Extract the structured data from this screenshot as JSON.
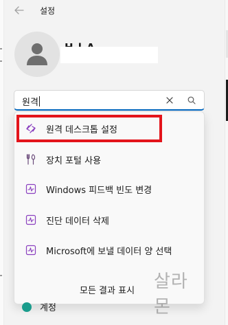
{
  "window": {
    "title": "설정"
  },
  "profile": {
    "name_visible": "H  l  A"
  },
  "search": {
    "value": "원격"
  },
  "results": [
    {
      "label": "원격 데스크톱 설정",
      "icon": "remote-desktop-icon",
      "highlighted": true
    },
    {
      "label": "장치 포털 사용",
      "icon": "tools-icon",
      "highlighted": false
    },
    {
      "label": "Windows 피드백 빈도 변경",
      "icon": "activity-chart-icon",
      "highlighted": false
    },
    {
      "label": "진단 데이터 삭제",
      "icon": "activity-chart-icon",
      "highlighted": false
    },
    {
      "label": "Microsoft에 보낼 데이터 양 선택",
      "icon": "activity-chart-icon",
      "highlighted": false
    }
  ],
  "show_all_label": "모든 결과 표시",
  "watermark": "살라몬",
  "nav_peek_label": "계정",
  "colors": {
    "accent": "#0067c0",
    "highlight_border": "#e3141b",
    "icon_purple": "#8a3fbf",
    "account_icon": "#1a9c8c"
  }
}
